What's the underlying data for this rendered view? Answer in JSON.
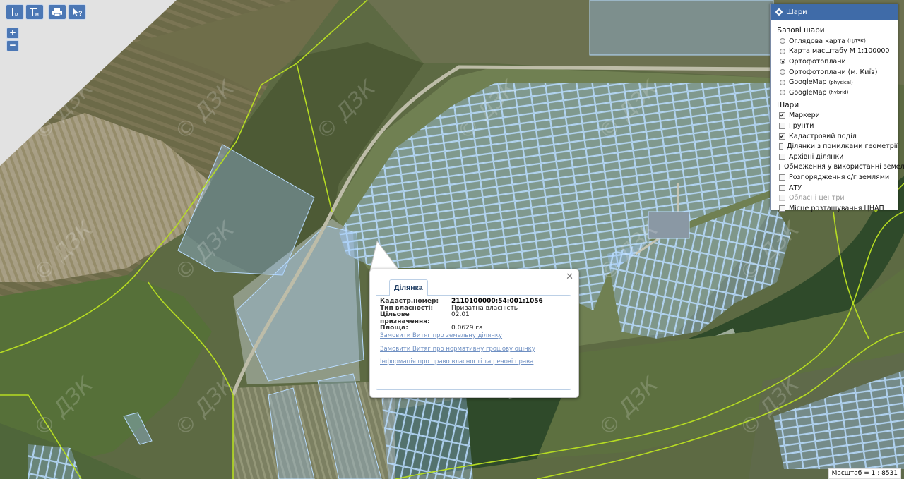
{
  "toolbar": {
    "measure_line_sub": "м",
    "measure_area_sub": "м",
    "print_icon": "printer-icon",
    "identify_icon": "cursor-question-icon"
  },
  "zoom": {
    "in_label": "+",
    "out_label": "−"
  },
  "layers_panel": {
    "title": "Шари",
    "base_section": "Базові шари",
    "base_layers": [
      {
        "label": "Оглядова карта",
        "sup": "(ЦДЗК)",
        "selected": false
      },
      {
        "label": "Карта масштабу М 1:100000",
        "sup": "",
        "selected": false
      },
      {
        "label": "Ортофотоплани",
        "sup": "",
        "selected": true
      },
      {
        "label": "Ортофотоплани (м. Київ)",
        "sup": "",
        "selected": false
      },
      {
        "label": "GoogleMap",
        "sup": "(physical)",
        "selected": false
      },
      {
        "label": "GoogleMap",
        "sup": "(hybrid)",
        "selected": false
      }
    ],
    "overlay_section": "Шари",
    "overlays": [
      {
        "label": "Маркери",
        "checked": true,
        "disabled": false
      },
      {
        "label": "Грунти",
        "checked": false,
        "disabled": false
      },
      {
        "label": "Кадастровий поділ",
        "checked": true,
        "disabled": false
      },
      {
        "label": "Ділянки з помилками геометрії",
        "checked": false,
        "disabled": false
      },
      {
        "label": "Архівні ділянки",
        "checked": false,
        "disabled": false
      },
      {
        "label": "Обмеження у використанні земель",
        "checked": false,
        "disabled": false
      },
      {
        "label": "Розпорядження с/г землями",
        "checked": false,
        "disabled": false
      },
      {
        "label": "АТУ",
        "checked": false,
        "disabled": false
      },
      {
        "label": "Обласні центри",
        "checked": false,
        "disabled": true
      },
      {
        "label": "Місце розташування ЦНАП",
        "checked": false,
        "disabled": false
      }
    ]
  },
  "popup": {
    "tab_label": "Ділянка",
    "attributes": [
      {
        "key": "Кадастр.номер:",
        "value": "2110100000:54:001:1056"
      },
      {
        "key": "Тип власності:",
        "value": "Приватна власність"
      },
      {
        "key": "Цільове призначення:",
        "value": "02.01"
      },
      {
        "key": "Площа:",
        "value": "0.0629 га"
      }
    ],
    "links": [
      "Замовити Витяг про земельну ділянку",
      "Замовити Витяг про нормативну грошову оцінку",
      "Інформація про право власності та речові права"
    ]
  },
  "watermark": "© ДЗК",
  "scale_text": "Масштаб = 1 : 8531",
  "colors": {
    "parcel_outline": "#9ec9ff",
    "boundary_line": "#b6dc22",
    "panel_header": "#3f6ba8",
    "tool_button": "#4b77b5",
    "link": "#6e8fc2"
  }
}
